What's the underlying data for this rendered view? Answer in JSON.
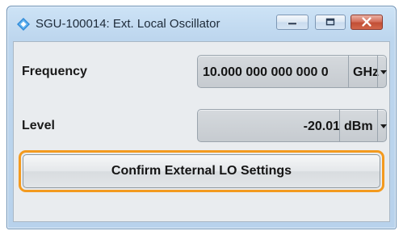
{
  "window": {
    "title": "SGU-100014: Ext. Local Oscillator",
    "icon": "rs-diamond-icon"
  },
  "controls": {
    "minimize_icon": "minimize-icon",
    "maximize_icon": "maximize-icon",
    "close_icon": "close-icon"
  },
  "frequency": {
    "label": "Frequency",
    "value": "10.000 000 000 000 0",
    "unit": "GHz"
  },
  "level": {
    "label": "Level",
    "value": "-20.01",
    "unit": "dBm"
  },
  "confirm_button": {
    "label": "Confirm External LO Settings"
  },
  "colors": {
    "focus_outline": "#f39a1f",
    "titlebar": "#bdd6ee",
    "close_button": "#c24f36"
  }
}
